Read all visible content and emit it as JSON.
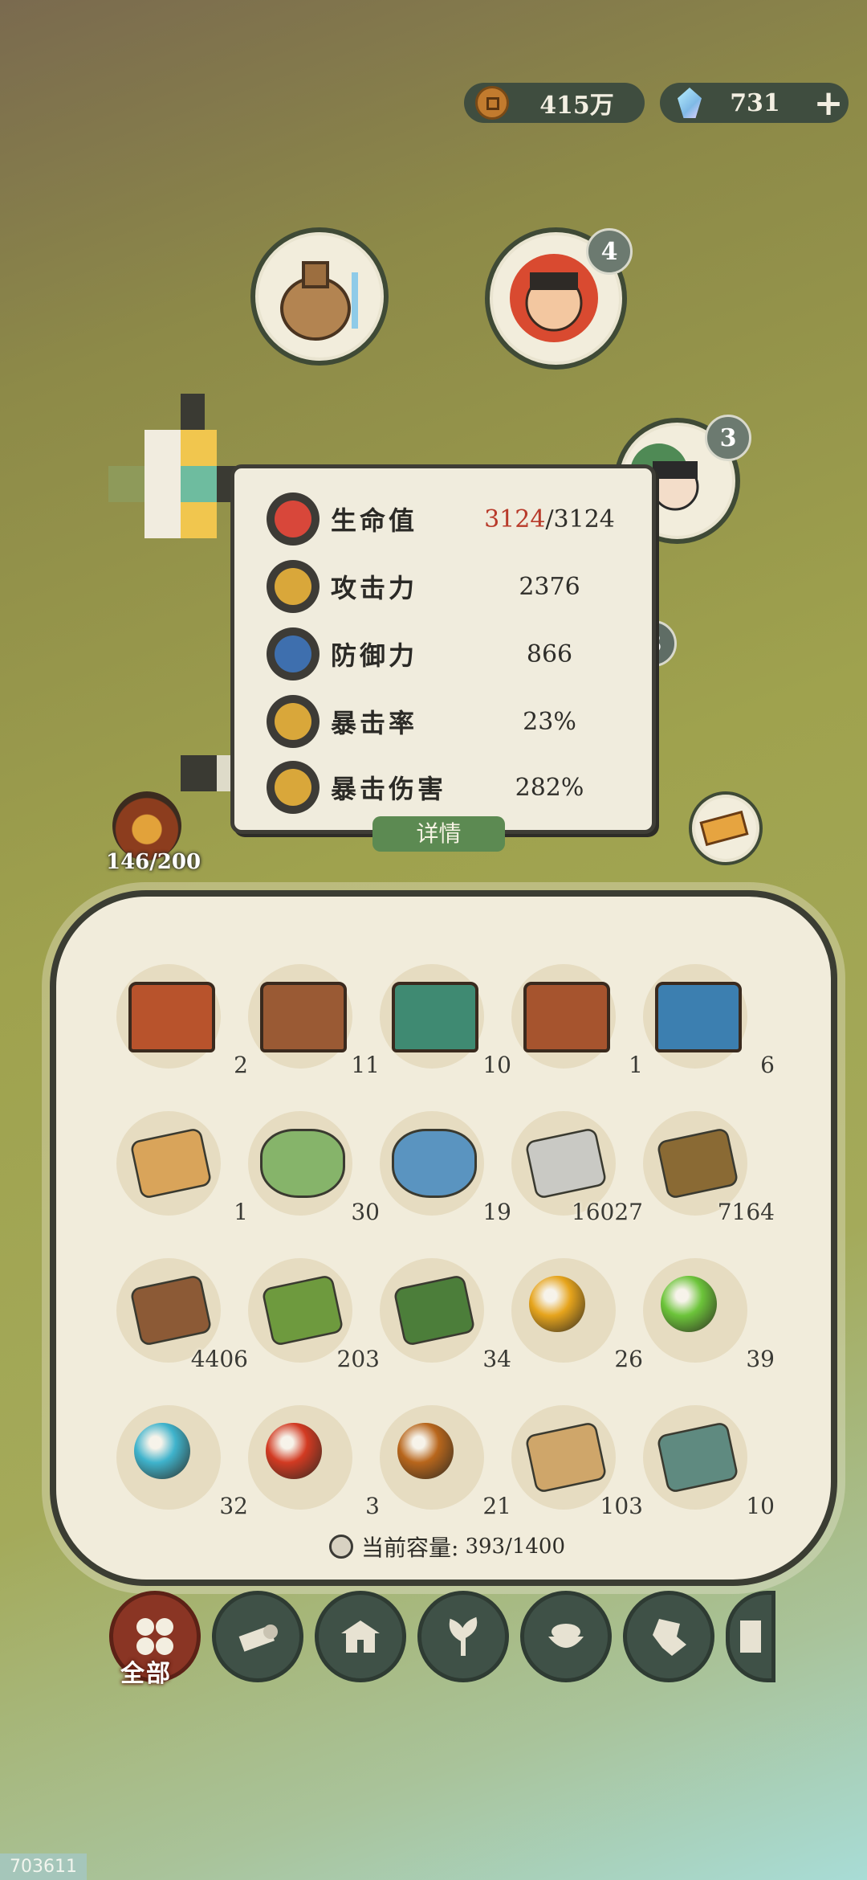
{
  "currencies": {
    "coins": "415万",
    "gems": "731",
    "add_label": "+"
  },
  "badges": {
    "hero_one": "4",
    "hero_two": "3",
    "hero_three": "3"
  },
  "stats": [
    {
      "label": "生命值",
      "value_current": "3124",
      "value_rest": "/3124",
      "icon": "heart-icon",
      "color": "#d8473a"
    },
    {
      "label": "攻击力",
      "value_current": "",
      "value_rest": "2376",
      "icon": "sword-icon",
      "color": "#d9a73a"
    },
    {
      "label": "防御力",
      "value_current": "",
      "value_rest": "866",
      "icon": "shield-person-icon",
      "color": "#3e6fae"
    },
    {
      "label": "暴击率",
      "value_current": "",
      "value_rest": "23%",
      "icon": "crit-rate-icon",
      "color": "#d9a73a"
    },
    {
      "label": "暴击伤害",
      "value_current": "",
      "value_rest": "282%",
      "icon": "crit-damage-icon",
      "color": "#d9a73a"
    }
  ],
  "food": {
    "count": "146/200"
  },
  "detail_button": "详情",
  "inventory": {
    "items": [
      {
        "name": "red-chest",
        "count": "2",
        "color": "#b8532c"
      },
      {
        "name": "brown-chest",
        "count": "11",
        "color": "#9a5a34"
      },
      {
        "name": "green-chest",
        "count": "10",
        "color": "#3f8a72"
      },
      {
        "name": "copper-chest",
        "count": "1",
        "color": "#a6542e"
      },
      {
        "name": "blue-chest",
        "count": "6",
        "color": "#3c7fb0"
      },
      {
        "name": "scroll",
        "count": "1",
        "color": "#d9a45a"
      },
      {
        "name": "green-pouch",
        "count": "30",
        "color": "#86b46a"
      },
      {
        "name": "blue-pouch",
        "count": "19",
        "color": "#5a94c0"
      },
      {
        "name": "stone",
        "count": "16027",
        "color": "#c9c9c4"
      },
      {
        "name": "straw",
        "count": "7164",
        "color": "#8a6a34"
      },
      {
        "name": "log",
        "count": "4406",
        "color": "#8c5a36"
      },
      {
        "name": "bamboo",
        "count": "203",
        "color": "#6e9a3e"
      },
      {
        "name": "herb",
        "count": "34",
        "color": "#4c7e3a"
      },
      {
        "name": "gold-orb",
        "count": "26",
        "color": "#e6a41c"
      },
      {
        "name": "green-orb",
        "count": "39",
        "color": "#6cc43a"
      },
      {
        "name": "cyan-orb",
        "count": "32",
        "color": "#3fb3cc"
      },
      {
        "name": "fire-orb",
        "count": "3",
        "color": "#d23a22"
      },
      {
        "name": "amber-orb",
        "count": "21",
        "color": "#b8661c"
      },
      {
        "name": "wood-plank",
        "count": "103",
        "color": "#cfa66a"
      },
      {
        "name": "jade-ingot",
        "count": "10",
        "color": "#5f8a80"
      }
    ],
    "capacity_label": "当前容量:",
    "capacity_value": "393/1400"
  },
  "tabs": {
    "all_label": "全部"
  },
  "build_id": "703611"
}
